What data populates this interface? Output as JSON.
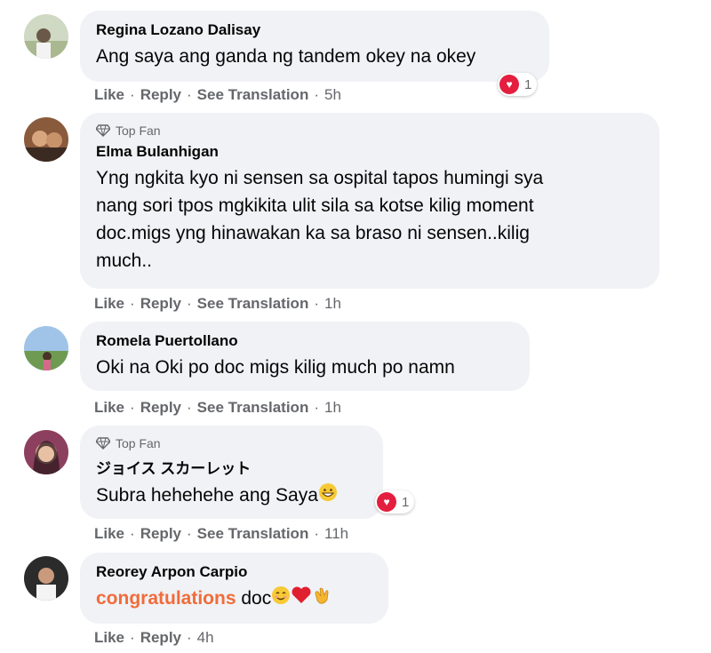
{
  "comments": [
    {
      "author": "Regina Lozano Dalisay",
      "top_fan": "",
      "text": "Ang saya ang ganda ng tandem okey na okey",
      "actions": {
        "like": "Like",
        "reply": "Reply",
        "translate": "See Translation",
        "time": "5h"
      },
      "reaction_count": "1"
    },
    {
      "author": "Elma Bulanhigan",
      "top_fan": "Top Fan",
      "text_lines": [
        "Yng ngkita kyo ni sensen sa ospital tapos humingi sya",
        "nang sori tpos mgkikita ulit sila sa kotse kilig moment",
        "doc.migs yng hinawakan ka sa braso ni sensen..kilig",
        "much.."
      ],
      "actions": {
        "like": "Like",
        "reply": "Reply",
        "translate": "See Translation",
        "time": "1h"
      }
    },
    {
      "author": "Romela Puertollano",
      "top_fan": "",
      "text": "Oki na Oki po doc migs kilig much po namn",
      "actions": {
        "like": "Like",
        "reply": "Reply",
        "translate": "See Translation",
        "time": "1h"
      }
    },
    {
      "author": "ジョイス スカーレット",
      "top_fan": "Top Fan",
      "text": "Subra hehehehe ang Saya",
      "actions": {
        "like": "Like",
        "reply": "Reply",
        "translate": "See Translation",
        "time": "11h"
      },
      "reaction_count": "1"
    },
    {
      "author": "Reorey Arpon Carpio",
      "top_fan": "",
      "text_highlight": "congratulations",
      "text_rest": " doc",
      "actions": {
        "like": "Like",
        "reply": "Reply",
        "time": "4h"
      }
    }
  ],
  "separator": "·",
  "colors": {
    "bubble": "#f0f2f5",
    "meta": "#65676b",
    "congrats": "#f26b3a",
    "love": "#e41e3f",
    "like": "#1877f2"
  }
}
